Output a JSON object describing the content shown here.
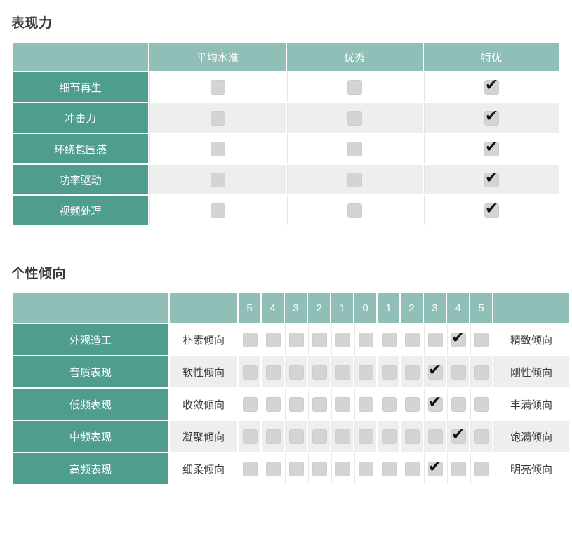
{
  "sections": [
    {
      "title": "表现力",
      "type": "rating-matrix",
      "columns": [
        "平均水准",
        "优秀",
        "特优"
      ],
      "rows": [
        {
          "label": "细节再生",
          "checked": [
            false,
            false,
            true
          ]
        },
        {
          "label": "冲击力",
          "checked": [
            false,
            false,
            true
          ]
        },
        {
          "label": "环绕包围感",
          "checked": [
            false,
            false,
            true
          ]
        },
        {
          "label": "功率驱动",
          "checked": [
            false,
            false,
            true
          ]
        },
        {
          "label": "视频处理",
          "checked": [
            false,
            false,
            true
          ]
        }
      ]
    },
    {
      "title": "个性倾向",
      "type": "bipolar-scale",
      "scale": [
        "5",
        "4",
        "3",
        "2",
        "1",
        "0",
        "1",
        "2",
        "3",
        "4",
        "5"
      ],
      "rows": [
        {
          "label": "外观造工",
          "left": "朴素倾向",
          "right": "精致倾向",
          "selected_index": 9
        },
        {
          "label": "音质表现",
          "left": "软性倾向",
          "right": "刚性倾向",
          "selected_index": 8
        },
        {
          "label": "低频表现",
          "left": "收敛倾向",
          "right": "丰满倾向",
          "selected_index": 8
        },
        {
          "label": "中频表现",
          "left": "凝聚倾向",
          "right": "饱满倾向",
          "selected_index": 9
        },
        {
          "label": "高频表现",
          "left": "细柔倾向",
          "right": "明亮倾向",
          "selected_index": 8
        }
      ]
    }
  ],
  "colors": {
    "header_teal": "#8fbfb6",
    "rowhead_teal": "#4f9d8d",
    "stripe": "#eeeeee",
    "checkbox": "#d4d4d4",
    "check_mark": "#111111",
    "text": "#3a3a3a"
  }
}
